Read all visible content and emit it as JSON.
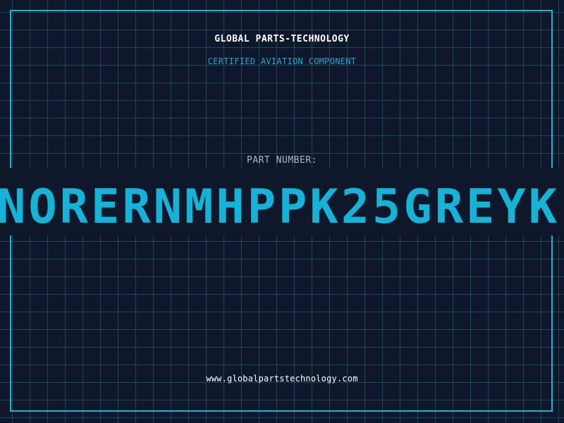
{
  "label": {
    "company": "GLOBAL PARTS-TECHNOLOGY",
    "subtitle": "CERTIFIED AVIATION COMPONENT",
    "part_label": "PART NUMBER:",
    "part_number": "NORERNMHPPK25GREYK",
    "website": "www.globalpartstechnology.com"
  },
  "colors": {
    "background": "#0f172b",
    "accent": "#22b2d8",
    "grid": "#38bddc",
    "text_primary": "#ffffff",
    "text_muted": "#aab4c4"
  }
}
